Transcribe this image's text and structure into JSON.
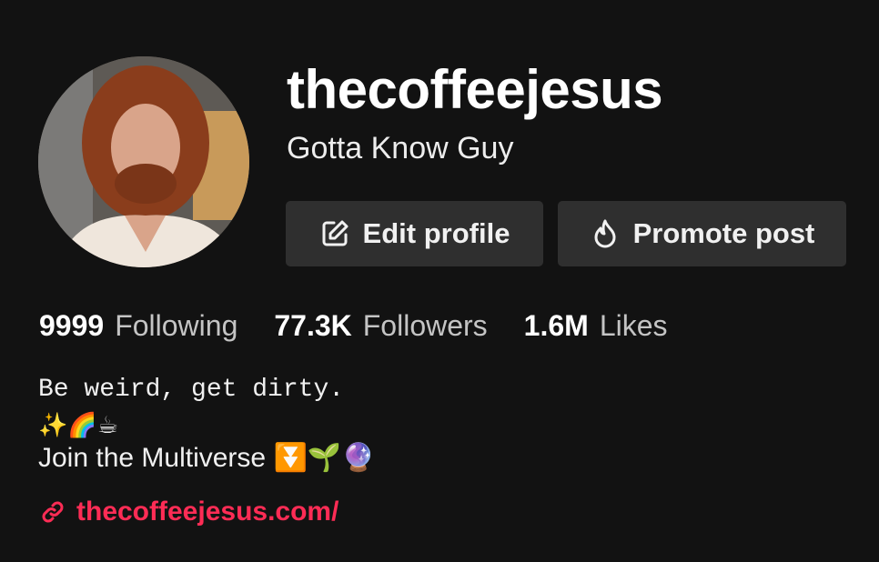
{
  "profile": {
    "username": "thecoffeejesus",
    "nickname": "Gotta Know Guy"
  },
  "actions": {
    "edit_label": "Edit profile",
    "promote_label": "Promote post"
  },
  "stats": {
    "following": {
      "value": "9999",
      "label": "Following"
    },
    "followers": {
      "value": "77.3K",
      "label": "Followers"
    },
    "likes": {
      "value": "1.6M",
      "label": "Likes"
    }
  },
  "bio": {
    "line1": "Be weird, get dirty.",
    "line2": "✨🌈☕",
    "line3": "Join the Multiverse ⏬🌱🔮"
  },
  "link": {
    "text": "thecoffeejesus.com/"
  },
  "colors": {
    "background": "#121212",
    "button": "#2f2f2f",
    "link": "#fe2c55"
  },
  "icons": {
    "edit": "edit-icon",
    "promote": "flame-icon",
    "link": "link-icon"
  }
}
